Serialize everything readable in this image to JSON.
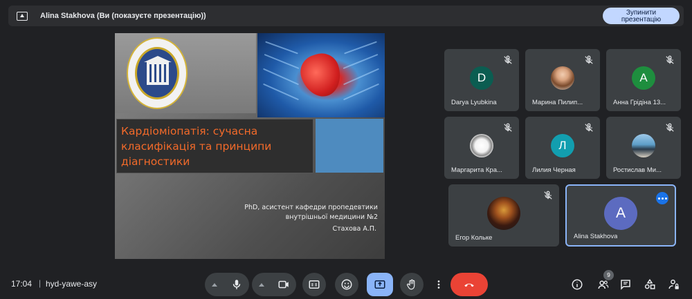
{
  "topbar": {
    "title": "Alina Stakhova (Ви (показуєте презентацію))",
    "stop_label_line1": "Зупинити",
    "stop_label_line2": "презентацію"
  },
  "slide": {
    "title": "Кардіоміопатія: сучасна класифікація та принципи діагностики",
    "author_line1": "PhD, асистент кафедри пропедевтики",
    "author_line2": "внутрішньої медицини №2",
    "author_name": "Стахова А.П."
  },
  "participants": [
    {
      "name": "Darya Lyubkina",
      "avatar": "D",
      "avatar_color": "#0b5d51",
      "mic_off": true
    },
    {
      "name": "Марина Пилип...",
      "avatar": "photo",
      "mic_off": true
    },
    {
      "name": "Анна Грідіна 13...",
      "avatar": "A",
      "avatar_color": "#1e8e3e",
      "mic_off": true
    },
    {
      "name": "Маргарита Кра...",
      "avatar": "photo",
      "mic_off": true
    },
    {
      "name": "Лилия Черная",
      "avatar": "Л",
      "avatar_color": "#129eaf",
      "mic_off": true
    },
    {
      "name": "Ростислав Ми...",
      "avatar": "photo",
      "mic_off": true
    },
    {
      "name": "Егор Кольке",
      "avatar": "photo",
      "mic_off": true
    },
    {
      "name": "Alina Stakhova",
      "avatar": "A",
      "avatar_color": "#5c6bc0",
      "mic_off": false,
      "speaking": true
    }
  ],
  "bottom": {
    "time": "17:04",
    "separator": "|",
    "meeting_code": "hyd-yawe-asy",
    "participants_count": "9"
  },
  "colors": {
    "background": "#202124",
    "tile": "#3c4043",
    "accent_blue": "#8ab4f8",
    "end_call": "#ea4335",
    "stop_button": "#c2d7ff"
  }
}
